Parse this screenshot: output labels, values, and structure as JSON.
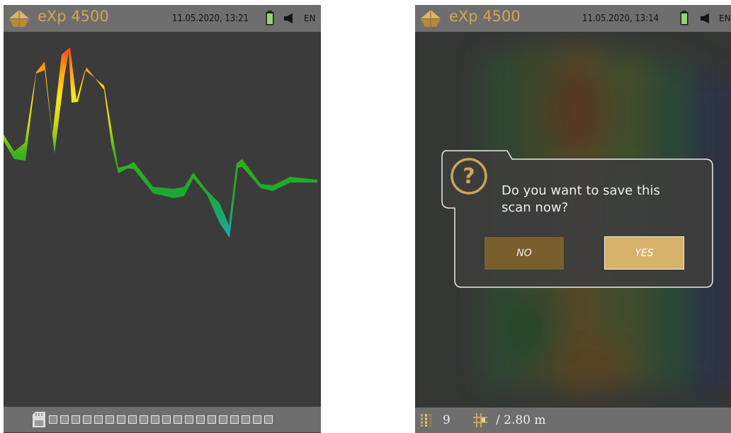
{
  "left_screen": {
    "brand": "eXp 4500",
    "datetime": "11.05.2020, 13:21",
    "language": "EN",
    "progress": {
      "filled": 0,
      "total": 20
    }
  },
  "right_screen": {
    "brand": "eXp 4500",
    "datetime": "11.05.2020, 13:14",
    "language": "EN",
    "dialog": {
      "message_line1": "Do you want to save this",
      "message_line2": "scan now?",
      "no_label": "NO",
      "yes_label": "YES",
      "icon": "question-icon"
    },
    "status": {
      "count": "9",
      "length": "/ 2.80 m"
    }
  },
  "colors": {
    "accent": "#d2a64e",
    "bar": "#6e6e6e",
    "screen_bg": "#3c3b3b",
    "no_button": "#7a5f2e",
    "yes_button": "#d6b26a"
  }
}
